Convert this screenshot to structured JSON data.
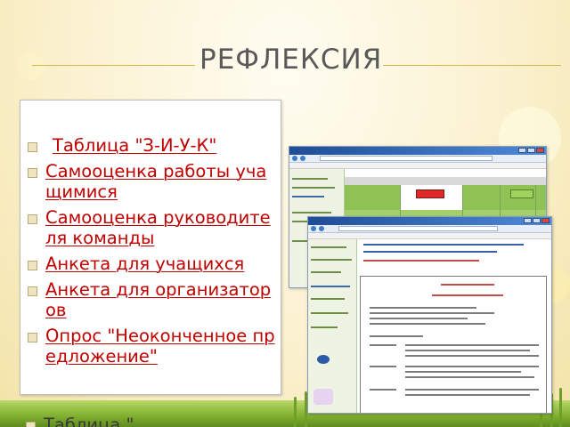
{
  "slide": {
    "title": "РЕФЛЕКСИЯ",
    "items": [
      {
        "label": "Таблица \"З-И-У-К\""
      },
      {
        "label": "Самооценка работы учащимися"
      },
      {
        "label": "Самооценка руководителя команды"
      },
      {
        "label": "Анкета для учащихся"
      },
      {
        "label": "Анкета для организаторов"
      },
      {
        "label": "Опрос \"Неоконченное предложение\""
      }
    ],
    "overflow_item": "Таблица \""
  },
  "screenshots": {
    "window1": {
      "icon": "browser-window-icon"
    },
    "window2": {
      "icon": "browser-window-icon"
    }
  },
  "colors": {
    "link": "#c00000",
    "title": "#595959",
    "accent_line": "#d9b64c",
    "grass": "#7fae2e"
  }
}
